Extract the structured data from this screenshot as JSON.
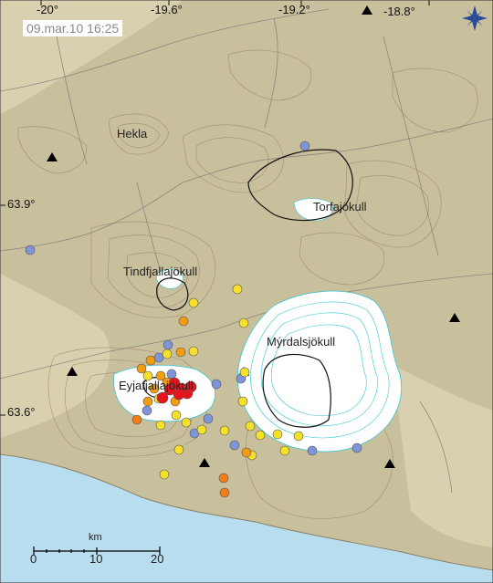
{
  "timestamp": "09.mar.10 16:25",
  "lon_labels": [
    "-20°",
    "-19.6°",
    "-19.2°",
    "-18.8°"
  ],
  "lat_labels": [
    "63.9°",
    "63.6°"
  ],
  "place_names": {
    "hekla": "Hekla",
    "torfajokull": "Torfajökull",
    "tindfjallajokull": "Tindfjallajökull",
    "myrdalsjokull": "Mýrdalsjökull",
    "eyjafjallajokull": "Eyjafjallajökull"
  },
  "scale": {
    "unit": "km",
    "ticks": [
      "0",
      "10",
      "20"
    ]
  },
  "colors": {
    "land": "#c8bf9c",
    "sea": "#b8ddef",
    "lowland": "#d8d0af",
    "contour": "#9a7a62",
    "glacier": "#ffffff",
    "glacier_contour": "#35c7d3",
    "roads": "#7a7a7a",
    "quake_red": "#e8141e",
    "quake_orange": "#f39c12",
    "quake_yellow": "#f5e12a",
    "quake_blue": "#7f95d9",
    "quake_dark_orange": "#f07d16"
  },
  "legend_icons": [
    "compass-icon",
    "station-triangle-icon",
    "earthquake-dot-icon",
    "caldera-rim-icon"
  ]
}
